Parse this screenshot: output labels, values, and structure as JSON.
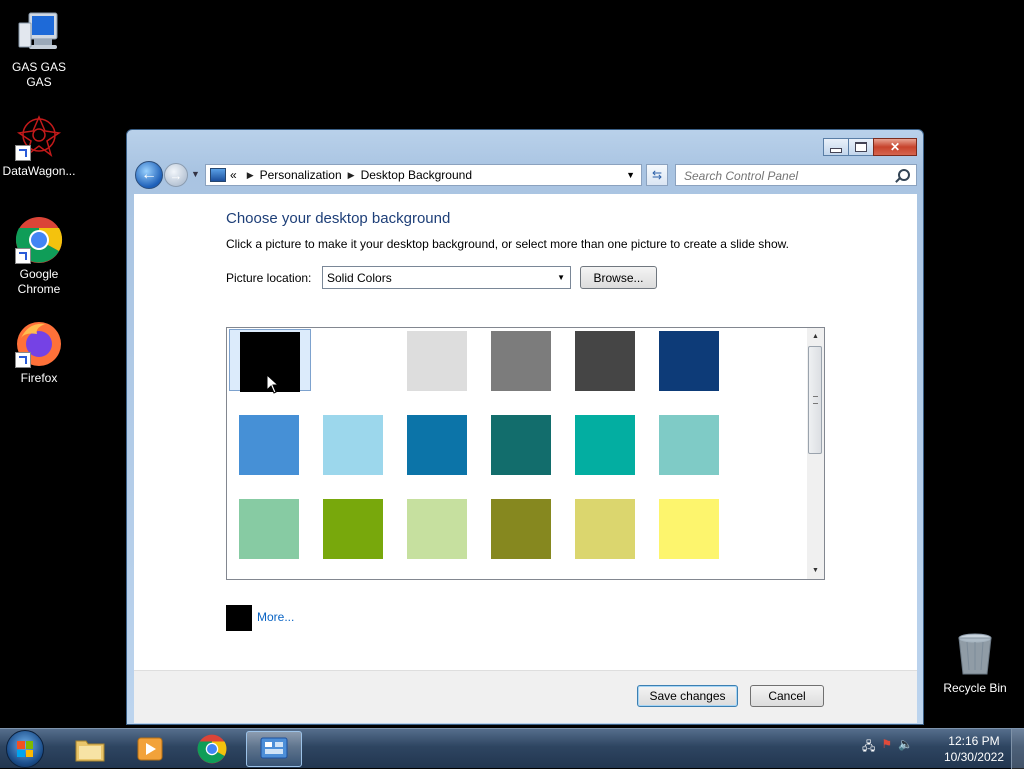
{
  "desktop": {
    "icons": [
      {
        "label": "GAS GAS GAS",
        "icon": "computer-icon"
      },
      {
        "label": "DataWagon...",
        "icon": "datawagon-icon"
      },
      {
        "label": "Google Chrome",
        "icon": "chrome-icon"
      },
      {
        "label": "Firefox",
        "icon": "firefox-icon"
      },
      {
        "label": "Recycle Bin",
        "icon": "recycle-bin-icon"
      }
    ]
  },
  "window": {
    "breadcrumb": {
      "chevrons": "«",
      "items": [
        "Personalization",
        "Desktop Background"
      ]
    },
    "search": {
      "placeholder": "Search Control Panel"
    },
    "heading": "Choose your desktop background",
    "description": "Click a picture to make it your desktop background, or select more than one picture to create a slide show.",
    "picture_location": {
      "label": "Picture location:",
      "value": "Solid Colors"
    },
    "browse_label": "Browse...",
    "swatches": [
      {
        "color": "#000000",
        "selected": true
      },
      {
        "color": "#ffffff",
        "selected": false
      },
      {
        "color": "#dddddd",
        "selected": false
      },
      {
        "color": "#7c7c7c",
        "selected": false
      },
      {
        "color": "#454545",
        "selected": false
      },
      {
        "color": "#0d3b78",
        "selected": false
      },
      {
        "color": "#4690d6",
        "selected": false
      },
      {
        "color": "#9cd7ec",
        "selected": false
      },
      {
        "color": "#0c74a8",
        "selected": false
      },
      {
        "color": "#126d6c",
        "selected": false
      },
      {
        "color": "#03aea1",
        "selected": false
      },
      {
        "color": "#7fcbc6",
        "selected": false
      },
      {
        "color": "#87cba3",
        "selected": false
      },
      {
        "color": "#78a80c",
        "selected": false
      },
      {
        "color": "#c6e09f",
        "selected": false
      },
      {
        "color": "#86881f",
        "selected": false
      },
      {
        "color": "#dbd66e",
        "selected": false
      },
      {
        "color": "#fdf56d",
        "selected": false
      }
    ],
    "more": {
      "label": "More...",
      "color": "#000000"
    },
    "save_label": "Save changes",
    "cancel_label": "Cancel"
  },
  "taskbar": {
    "clock": {
      "time": "12:16 PM",
      "date": "10/30/2022"
    }
  }
}
